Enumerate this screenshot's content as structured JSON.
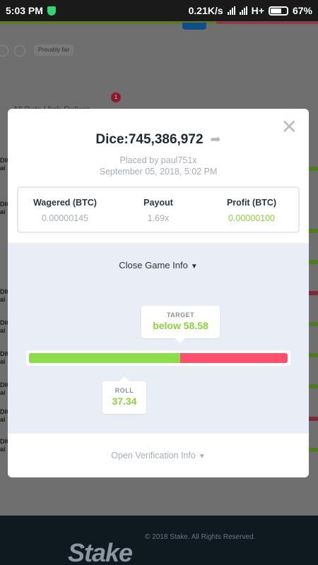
{
  "status_bar": {
    "time": "5:03 PM",
    "network_speed": "0.21K/s",
    "network_type": "H+",
    "battery": "67%"
  },
  "background": {
    "chip_label": "Provably fair",
    "badge_count": "1",
    "tabs_text": "All Bets      High Rollers",
    "footer_copyright": "© 2018 Stake. All Rights Reserved.",
    "logo": "Stake"
  },
  "modal": {
    "title": "Dice:745,386,972",
    "placed_by": "Placed by paul751x",
    "date": "September 05, 2018, 5:02 PM",
    "stats": [
      {
        "label": "Wagered (BTC)",
        "value": "0.00000145"
      },
      {
        "label": "Payout",
        "value": "1.69x"
      },
      {
        "label": "Profit (BTC)",
        "value": "0.00000100"
      }
    ],
    "close_info_label": "Close Game Info",
    "target": {
      "label": "TARGET",
      "value": "below 58.58",
      "position": 58.58
    },
    "roll": {
      "label": "ROLL",
      "value": "37.34",
      "position": 37.34
    },
    "verify_label": "Open Verification Info"
  },
  "colors": {
    "win": "#8ddc4a",
    "lose": "#ff4f6e",
    "text_dark": "#1f2a33",
    "muted": "#a7adb5"
  }
}
